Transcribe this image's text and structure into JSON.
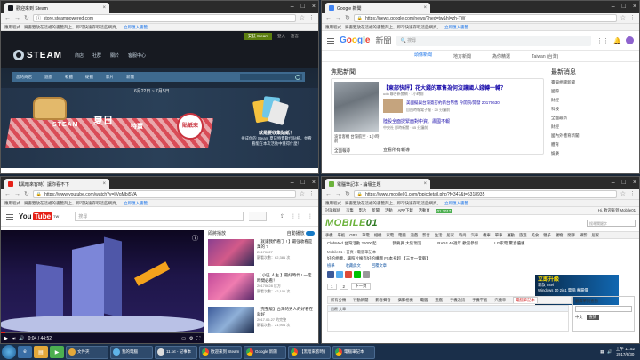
{
  "steam": {
    "tab_title": "歡迎來到 Steam",
    "url": "store.steampowered.com",
    "bookmarks_label": "應用程式",
    "bookmarks_hint": "將書籤放在這裡的書籤列上，即可快速存取這些網頁。",
    "bookmarks_import": "立即匯入書籤...",
    "install_label": "安裝 Steam",
    "login_label": "登入",
    "lang_label": "語言",
    "logo_text": "STEAM",
    "nav": [
      "商店",
      "社群",
      "關於",
      "客服中心"
    ],
    "storebar": [
      "您的商店",
      "遊戲",
      "軟體",
      "硬體",
      "影片",
      "新聞"
    ],
    "search_placeholder": "搜尋",
    "sale_dates": "6月22日 ~ 7月5日",
    "sale_title_en": "STEAM",
    "sale_title_zh": "夏日",
    "sale_title_special": "特賣",
    "sticker": "貼紙來",
    "card_promo_title": "就是要收集貼紙！",
    "card_promo_text": "拼成你的 Steam 夏日特賣數位貼紙，並看看能在本次活動中獲得什麼！"
  },
  "news": {
    "tab_title": "Google 新聞",
    "url": "https://news.google.com/news/?hed=tw&hl=zh-TW",
    "bookmarks_label": "應用程式",
    "bookmarks_hint": "將書籤放在這裡的書籤列上，即可快速存取這些網頁。",
    "bookmarks_import": "立即匯入書籤...",
    "logo_letters": [
      "G",
      "o",
      "o",
      "g",
      "l",
      "e"
    ],
    "logo_suffix": "新聞",
    "search_placeholder": "搜尋",
    "tabs": [
      "頭條新聞",
      "地方新聞",
      "為你精選",
      "Taiwan (台灣)"
    ],
    "section_title": "焦點新聞",
    "right_title": "最新消息",
    "headline1": "【東部快評】花大錢的軍售為何沒讓國人錢轉一轉？",
    "headline1_source": "udn 聯合新聞網 · 1小時前",
    "sub1_title": "美國擬與台灣簽訂約新台幣售 今開院/開發 20170630",
    "sub1_meta": "自由時報電子報 · 20 分鐘前",
    "headline2": "陸股全面捉緊面對中資、肅國不報",
    "headline2_meta": "中央社 即時新聞 · 45 分鐘前",
    "caption": "波音客機 台灣航空 · 1小時前",
    "full_coverage": "全面報導",
    "more_label": "查看所有報導",
    "side_items": [
      "臺灣相關新聞",
      "國際",
      "財經",
      "科技",
      "全國最新",
      "財經",
      "國內外體育新聞",
      "體育",
      "娛樂",
      "健康"
    ]
  },
  "youtube": {
    "tab_title": "【黑暗來客時】讓你看不下",
    "url": "https://www.youtube.com/watch?v=ljVqMbj5VA",
    "bookmarks_label": "應用程式",
    "bookmarks_hint": "將書籤放在這裡的書籤列上，即可快速存取這些網頁。",
    "bookmarks_import": "立即匯入書籤...",
    "logo_you": "You",
    "logo_tube": "Tube",
    "logo_region": "TW",
    "search_placeholder": "搜尋",
    "up_next": "即將播放",
    "autoplay": "自動播放",
    "time": "0:04 / 44:52",
    "progress": 0.02,
    "videos": [
      {
        "title": "【就讓我們看了 ! 】最強收看是萬的 ?",
        "channel": "20170627",
        "views": "觀看次數：62,381 次"
      },
      {
        "title": "【 小區 人生 】最好時代 ! 一定時間必看！",
        "channel": "20170628 官方",
        "views": "觀看次數：42,101 次"
      },
      {
        "title": "【完整版】台灣的男人的好看在就好",
        "channel": "2017.06.27 的完整",
        "views": "觀看次數：21,901 次"
      }
    ]
  },
  "mobile01": {
    "tab_title": "電腦筆記本 - 論壇主題",
    "url": "https://www.mobile01.com/topicdetail.php?f=347&t=5318935",
    "bookmarks_label": "應用程式",
    "bookmarks_hint": "將書籤放在這裡的書籤列上，即可快速存取這些網頁。",
    "bookmarks_import": "立即匯入書籤...",
    "top_links": [
      "討論群組",
      "市集",
      "影片",
      "新聞",
      "活動",
      "APP下載",
      "活動頁",
      "01 2017"
    ],
    "top_event": "01 2017",
    "user": "Hi, 歡迎來到 Mobile01",
    "logo_main": "MOBILE",
    "logo_tail": "01",
    "search_placeholder": "搜尋關鍵字",
    "nav": [
      "手機",
      "平板",
      "GPS",
      "筆電",
      "相機",
      "家電",
      "電腦",
      "遊戲",
      "影音",
      "生活",
      "居家",
      "時尚",
      "汽車",
      "機車",
      "單車",
      "運動",
      "旅遊",
      "美食",
      "親子",
      "寵物",
      "閒聊",
      "攝影",
      "居家"
    ],
    "promo_links": [
      "ClubMed 台灣活動 26000起",
      "我要買 大陸現況",
      "RAV4 40週年 歡迎參加",
      "LG家電 驚喜優惠"
    ],
    "crumb": "Mobile01 › 首頁 › 電腦筆記本",
    "title": "好的相機，讓照片擁有好的構圖 F5本身超 【三合一電腦】",
    "actions": [
      "檢舉",
      "收藏此文",
      "回覆文章"
    ],
    "pages": [
      "1",
      "2",
      "下一頁"
    ],
    "ad_brand": "立即升級",
    "ad_line1": "新款 Intel",
    "ad_line2": "Windows 10 2in1 電腦 專屬價",
    "tabs": [
      "所有分類",
      "行動新聞",
      "影音聲音",
      "攝影相機",
      "電腦",
      "遊戲",
      "手機通訊",
      "手機平板",
      "汽機車",
      "網路購物"
    ],
    "tab_active": "電腦筆記本",
    "content_bar": "回覆 文章",
    "dict_title": "翻譯單詞查詢",
    "dict_lang": "中文",
    "dict_go": "查詢"
  },
  "taskbar": {
    "items": [
      "文件夾",
      "我的電腦",
      "11.txt - 記事本",
      "歡迎來到 Steam",
      "Google 新聞",
      "【黑暗來客時】",
      "電腦筆記本"
    ],
    "time": "上午 11:52",
    "date": "2017/6/30"
  }
}
